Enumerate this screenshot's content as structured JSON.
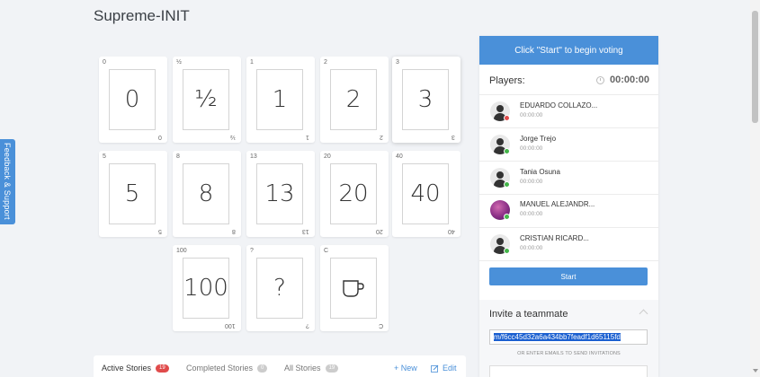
{
  "page": {
    "title": "Supreme-INIT"
  },
  "feedback": {
    "label": "Feedback & Support"
  },
  "cards": [
    {
      "value": "0",
      "corner": "0"
    },
    {
      "value": "½",
      "corner": "½"
    },
    {
      "value": "1",
      "corner": "1"
    },
    {
      "value": "2",
      "corner": "2"
    },
    {
      "value": "3",
      "corner": "3"
    },
    {
      "value": "5",
      "corner": "5"
    },
    {
      "value": "8",
      "corner": "8"
    },
    {
      "value": "13",
      "corner": "13"
    },
    {
      "value": "20",
      "corner": "20"
    },
    {
      "value": "40",
      "corner": "40"
    },
    {
      "value": "100",
      "corner": "100"
    },
    {
      "value": "?",
      "corner": "?"
    },
    {
      "value": "",
      "corner": "C",
      "icon": "coffee-cup-icon"
    }
  ],
  "stories": {
    "tabs": [
      {
        "label": "Active Stories",
        "count": "19"
      },
      {
        "label": "Completed Stories",
        "count": "0"
      },
      {
        "label": "All Stories",
        "count": "19"
      }
    ],
    "new_label": "+ New",
    "edit_label": "Edit"
  },
  "voting": {
    "banner": "Click \"Start\" to begin voting"
  },
  "players": {
    "label": "Players:",
    "timer": "00:00:00",
    "list": [
      {
        "name": "EDUARDO COLLAZO...",
        "time": "00:00:00",
        "status": "offline",
        "avatar": "default"
      },
      {
        "name": "Jorge Trejo",
        "time": "00:00:00",
        "status": "online",
        "avatar": "default"
      },
      {
        "name": "Tania Osuna",
        "time": "00:00:00",
        "status": "online",
        "avatar": "default"
      },
      {
        "name": "MANUEL ALEJANDR...",
        "time": "00:00:00",
        "status": "online",
        "avatar": "photo"
      },
      {
        "name": "CRISTIAN RICARD...",
        "time": "00:00:00",
        "status": "online",
        "avatar": "default"
      }
    ],
    "start_label": "Start"
  },
  "invite": {
    "title": "Invite a teammate",
    "link": "m/f6cc45d32a6a434bb7feadf1d65115fd",
    "hint": "OR ENTER EMAILS TO SEND INVITATIONS"
  },
  "colors": {
    "accent": "#4a90d9",
    "badge_red": "#e04b4b",
    "online": "#44b54a",
    "offline": "#e04b4b"
  }
}
